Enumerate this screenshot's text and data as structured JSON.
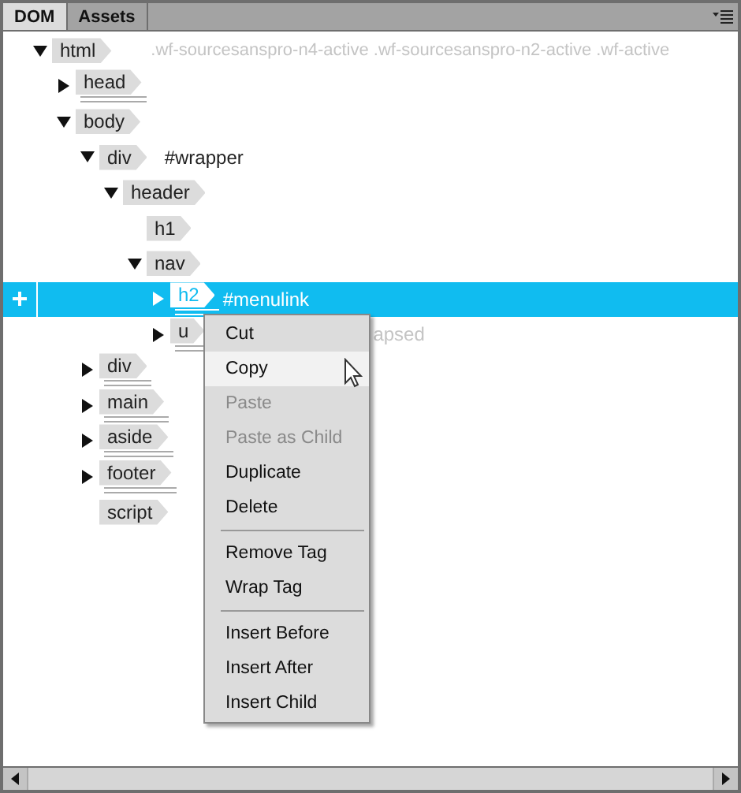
{
  "tabs": [
    {
      "label": "DOM",
      "selected": true
    },
    {
      "label": "Assets",
      "selected": false
    }
  ],
  "tree": [
    {
      "tag": "html",
      "kind": "expandable",
      "expanded": true,
      "selected": false,
      "note": ".wf-sourcesanspro-n4-active .wf-sourcesanspro-n2-active .wf-active",
      "note_dimmed": true,
      "children": [
        {
          "tag": "head",
          "kind": "expandable",
          "expanded": false,
          "selected": false
        },
        {
          "tag": "body",
          "kind": "expandable",
          "expanded": true,
          "selected": false,
          "children": [
            {
              "tag": "div",
              "kind": "expandable",
              "expanded": true,
              "selected": false,
              "note": "#wrapper",
              "note_dimmed": false,
              "children": [
                {
                  "tag": "header",
                  "kind": "expandable",
                  "expanded": true,
                  "selected": false,
                  "children": [
                    {
                      "tag": "h1",
                      "kind": "leaf",
                      "selected": false
                    },
                    {
                      "tag": "nav",
                      "kind": "expandable",
                      "expanded": true,
                      "selected": false,
                      "children": [
                        {
                          "tag": "h2",
                          "kind": "expandable",
                          "expanded": false,
                          "selected": true,
                          "note": "#menulink",
                          "note_dimmed": false
                        },
                        {
                          "tag": "u",
                          "kind": "expandable",
                          "expanded": false,
                          "selected": false,
                          "note": "apsed",
                          "note_dimmed": true
                        }
                      ]
                    }
                  ]
                }
              ]
            },
            {
              "tag": "div",
              "kind": "expandable",
              "expanded": false,
              "selected": false
            },
            {
              "tag": "main",
              "kind": "expandable",
              "expanded": false,
              "selected": false
            },
            {
              "tag": "aside",
              "kind": "expandable",
              "expanded": false,
              "selected": false
            },
            {
              "tag": "footer",
              "kind": "expandable",
              "expanded": false,
              "selected": false
            },
            {
              "tag": "script",
              "kind": "leaf",
              "selected": false
            }
          ]
        }
      ]
    }
  ],
  "context_menu": [
    {
      "kind": "item",
      "label": "Cut",
      "disabled": false,
      "selected": false
    },
    {
      "kind": "item",
      "label": "Copy",
      "disabled": false,
      "selected": true
    },
    {
      "kind": "item",
      "label": "Paste",
      "disabled": true,
      "selected": false
    },
    {
      "kind": "item",
      "label": "Paste as Child",
      "disabled": true,
      "selected": false
    },
    {
      "kind": "item",
      "label": "Duplicate",
      "disabled": false,
      "selected": false
    },
    {
      "kind": "item",
      "label": "Delete",
      "disabled": false,
      "selected": false
    },
    {
      "kind": "separator"
    },
    {
      "kind": "item",
      "label": "Remove Tag",
      "disabled": false,
      "selected": false
    },
    {
      "kind": "item",
      "label": "Wrap Tag",
      "disabled": false,
      "selected": false
    },
    {
      "kind": "separator"
    },
    {
      "kind": "item",
      "label": "Insert Before",
      "disabled": false,
      "selected": false
    },
    {
      "kind": "item",
      "label": "Insert After",
      "disabled": false,
      "selected": false
    },
    {
      "kind": "item",
      "label": "Insert Child",
      "disabled": false,
      "selected": false
    }
  ]
}
